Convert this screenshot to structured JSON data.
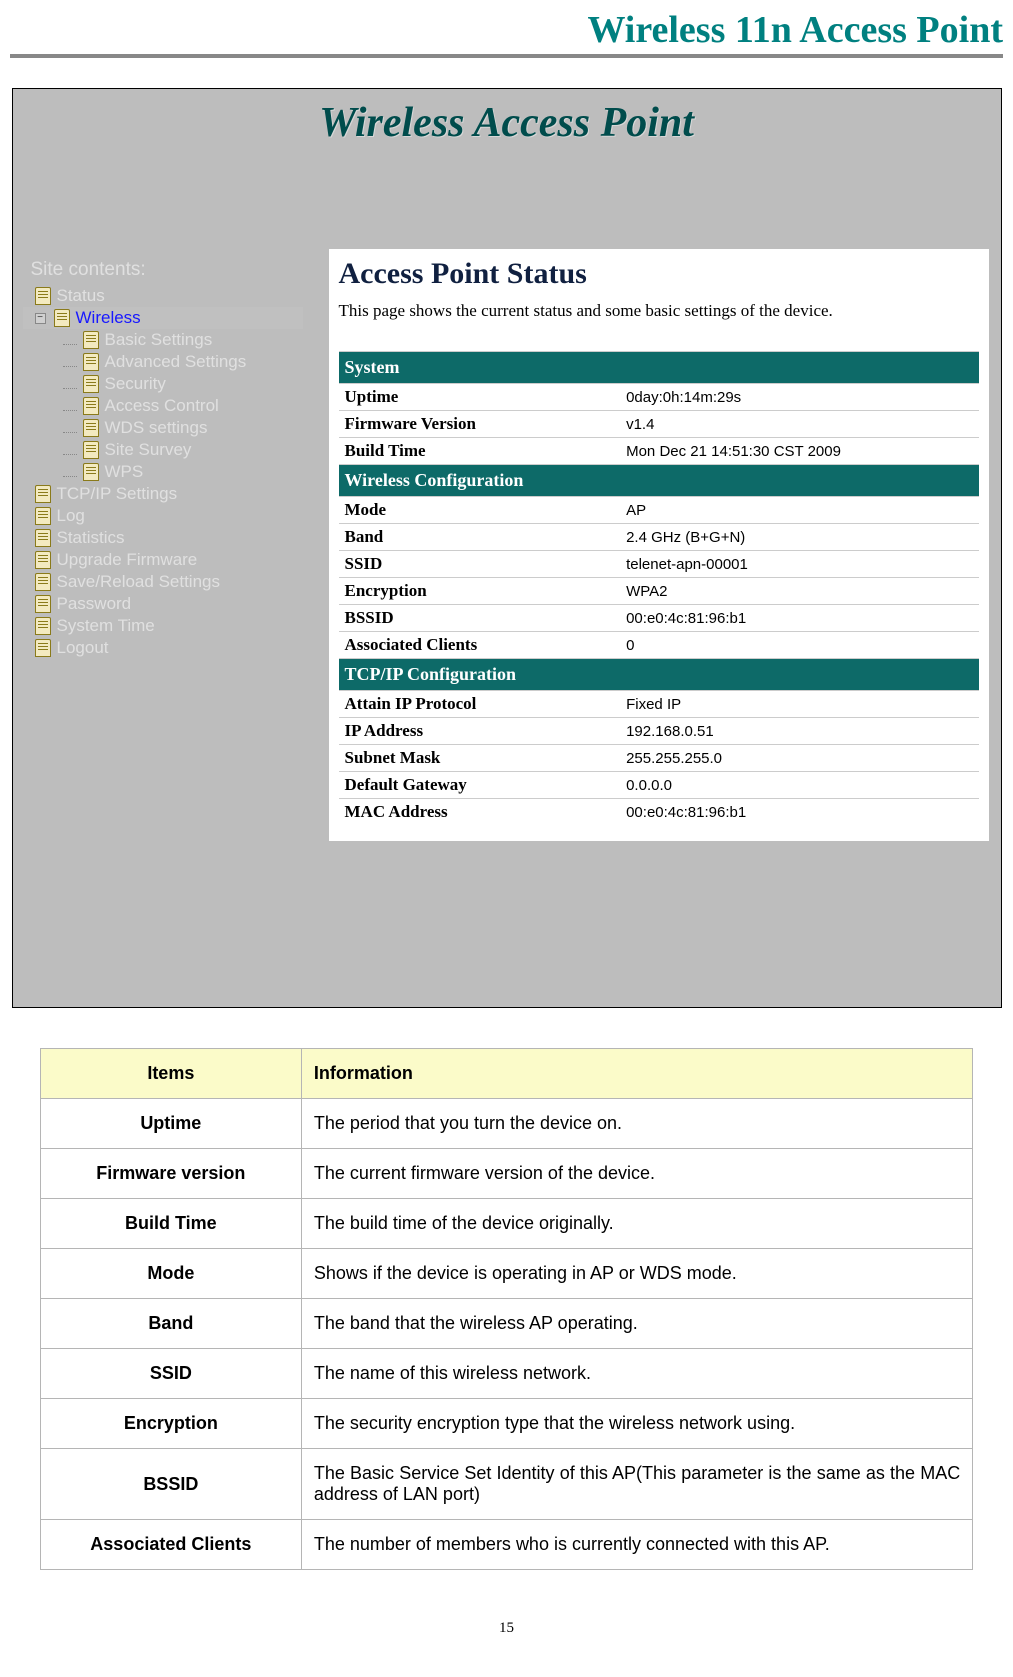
{
  "header": {
    "title": "Wireless 11n Access Point"
  },
  "page_number": "15",
  "shot": {
    "banner": "Wireless Access Point",
    "sidebar": {
      "heading": "Site contents:",
      "items": [
        {
          "label": "Status",
          "level": 1
        },
        {
          "label": "Wireless",
          "level": 1,
          "expandable": true,
          "selected": true
        },
        {
          "label": "Basic Settings",
          "level": 2
        },
        {
          "label": "Advanced Settings",
          "level": 2
        },
        {
          "label": "Security",
          "level": 2
        },
        {
          "label": "Access Control",
          "level": 2
        },
        {
          "label": "WDS settings",
          "level": 2
        },
        {
          "label": "Site Survey",
          "level": 2
        },
        {
          "label": "WPS",
          "level": 2
        },
        {
          "label": "TCP/IP Settings",
          "level": 1
        },
        {
          "label": "Log",
          "level": 1
        },
        {
          "label": "Statistics",
          "level": 1
        },
        {
          "label": "Upgrade Firmware",
          "level": 1
        },
        {
          "label": "Save/Reload Settings",
          "level": 1
        },
        {
          "label": "Password",
          "level": 1
        },
        {
          "label": "System Time",
          "level": 1
        },
        {
          "label": "Logout",
          "level": 1
        }
      ]
    },
    "content": {
      "title": "Access Point Status",
      "intro": "This page shows the current status and some basic settings of the device.",
      "sections": [
        {
          "header": "System",
          "rows": [
            {
              "label": "Uptime",
              "value": "0day:0h:14m:29s"
            },
            {
              "label": "Firmware Version",
              "value": "v1.4"
            },
            {
              "label": "Build Time",
              "value": "Mon Dec 21 14:51:30 CST 2009"
            }
          ]
        },
        {
          "header": "Wireless Configuration",
          "rows": [
            {
              "label": "Mode",
              "value": "AP"
            },
            {
              "label": "Band",
              "value": "2.4 GHz (B+G+N)"
            },
            {
              "label": "SSID",
              "value": "telenet-apn-00001"
            },
            {
              "label": "Encryption",
              "value": "WPA2"
            },
            {
              "label": "BSSID",
              "value": "00:e0:4c:81:96:b1"
            },
            {
              "label": "Associated Clients",
              "value": "0"
            }
          ]
        },
        {
          "header": "TCP/IP Configuration",
          "rows": [
            {
              "label": "Attain IP Protocol",
              "value": "Fixed IP"
            },
            {
              "label": "IP Address",
              "value": "192.168.0.51"
            },
            {
              "label": "Subnet Mask",
              "value": "255.255.255.0"
            },
            {
              "label": "Default Gateway",
              "value": "0.0.0.0"
            },
            {
              "label": "MAC Address",
              "value": "00:e0:4c:81:96:b1"
            }
          ]
        }
      ]
    }
  },
  "definitions": {
    "header": {
      "items": "Items",
      "info": "Information"
    },
    "rows": [
      {
        "item": "Uptime",
        "info": "The period that you turn the device on."
      },
      {
        "item": "Firmware version",
        "info": "The current firmware version of the device."
      },
      {
        "item": "Build Time",
        "info": "The build time of the device originally."
      },
      {
        "item": "Mode",
        "info": "Shows if the device is operating in AP or WDS mode."
      },
      {
        "item": "Band",
        "info": "The band that the wireless AP operating."
      },
      {
        "item": "SSID",
        "info": "The name of this wireless network."
      },
      {
        "item": "Encryption",
        "info": "The security encryption type that the wireless network using."
      },
      {
        "item": "BSSID",
        "info": "The Basic Service Set Identity of this AP(This parameter is the same as the MAC address of LAN port)"
      },
      {
        "item": "Associated Clients",
        "info": "The number of members who is currently connected with this AP."
      }
    ]
  }
}
